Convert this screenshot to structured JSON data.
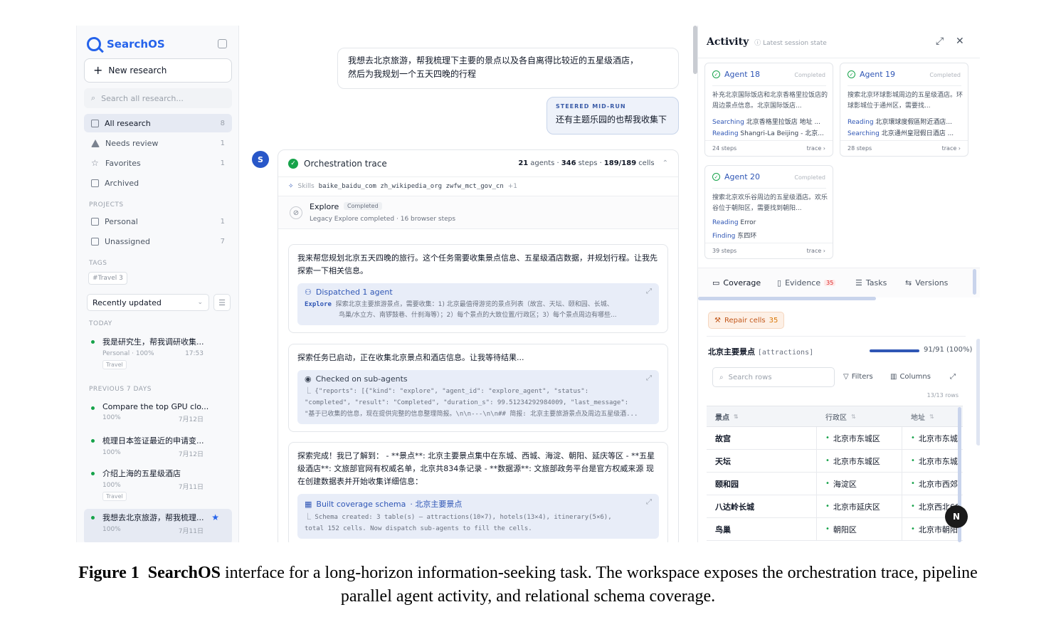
{
  "sidebar": {
    "brand": "SearchOS",
    "new_research": "New research",
    "search_placeholder": "Search all research...",
    "nav": [
      {
        "label": "All research",
        "count": "8"
      },
      {
        "label": "Needs review",
        "count": "1"
      },
      {
        "label": "Favorites",
        "count": "1"
      },
      {
        "label": "Archived",
        "count": ""
      }
    ],
    "projects_label": "PROJECTS",
    "projects": [
      {
        "label": "Personal",
        "count": "1"
      },
      {
        "label": "Unassigned",
        "count": "7"
      }
    ],
    "tags_label": "TAGS",
    "tag": "#Travel 3",
    "sort": "Recently updated",
    "today_label": "TODAY",
    "previous_label": "PREVIOUS 7 DAYS",
    "history": [
      {
        "title": "我是研究生，帮我调研收集...",
        "meta1": "Personal · 100%",
        "time": "17:53",
        "chip": "Travel"
      },
      {
        "title": "Compare the top GPU clo...",
        "meta1": "100%",
        "time": "7月12日",
        "chip": ""
      },
      {
        "title": "梳理日本签证最近的申请变...",
        "meta1": "100%",
        "time": "7月12日",
        "chip": ""
      },
      {
        "title": "介绍上海的五星级酒店",
        "meta1": "100%",
        "time": "7月11日",
        "chip": "Travel"
      },
      {
        "title": "我想去北京旅游，帮我梳理...",
        "meta1": "100%",
        "time": "7月11日",
        "chip": ""
      }
    ]
  },
  "chat": {
    "user_message_1": "我想去北京旅游，帮我梳理下主要的景点以及各自离得比较近的五星级酒店，",
    "user_message_2": "然后为我规划一个五天四晚的行程",
    "steer_label": "STEERED MID-RUN",
    "steer_message": "还有主题乐园的也帮我收集下",
    "avatar": "S",
    "trace": {
      "title": "Orchestration trace",
      "agents_num": "21",
      "agents_label": "agents ·",
      "steps_num": "346",
      "steps_label": "steps ·",
      "cells_num": "189/189",
      "cells_label": "cells",
      "skills_label": "Skills",
      "skills": "baike_baidu_com zh_wikipedia_org zwfw_mct_gov_cn",
      "skills_more": "+1",
      "explore_name": "Explore",
      "explore_badge": "Completed",
      "explore_sub": "Legacy Explore completed · 16 browser steps"
    },
    "cards": [
      {
        "text": "我来帮您规划北京五天四晚的旅行。这个任务需要收集景点信息、五星级酒店数据，并规划行程。让我先探索一下相关信息。",
        "tool_title": "Dispatched 1 agent",
        "tool_kw": "Explore",
        "tool_body_1": "探索北京主要旅游景点，需要收集：1) 北京最值得游览的景点列表（故宫、天坛、颐和园、长城、",
        "tool_body_2": "鸟巢/水立方、南锣鼓巷、什刹海等）；2）每个景点的大致位置/行政区；3）每个景点周边有哪些..."
      },
      {
        "text": "探索任务已启动，正在收集北京景点和酒店信息。让我等待结果...",
        "tool_title": "Checked on sub-agents",
        "mono_1": "⎿ {\"reports\": [{\"kind\": \"explore\", \"agent_id\": \"explore_agent\", \"status\":",
        "mono_2": "\"completed\", \"result\": \"Completed\", \"duration_s\": 99.51234292984009, \"last_message\":",
        "mono_3": "\"基于已收集的信息，现在提供完整的信息整理简报。\\n\\n---\\n\\n## 简报: 北京主要旅游景点及周边五星级酒..."
      },
      {
        "text": "探索完成！我已了解到： - **景点**: 北京主要景点集中在东城、西城、海淀、朝阳、延庆等区 - **五星级酒店**: 文旅部官网有权威名单，北京共834条记录 - **数据源**: 文旅部政务平台是官方权威来源 现在创建数据表并开始收集详细信息：",
        "tool_title": "Built coverage schema",
        "tool_title_sub": "· 北京主要景点",
        "mono_1": "⎿ Schema created: 3 table(s) — attractions(10×7), hotels(13×4), itinerary(5×6),",
        "mono_2": "total 152 cells. Now dispatch sub-agents to fill the cells."
      }
    ]
  },
  "activity": {
    "title": "Activity",
    "subtitle": "Latest session state",
    "agents": [
      {
        "name": "Agent 18",
        "status": "Completed",
        "desc": "补充北京国际饭店和北京香格里拉饭店的周边景点信息。北京国际饭店...",
        "verb1": "Searching",
        "obj1": "北京香格里拉饭店 地址 ...",
        "verb2": "Reading",
        "obj2": "Shangri-La Beijing - 北京...",
        "steps": "24 steps",
        "trace": "trace ›"
      },
      {
        "name": "Agent 19",
        "status": "Completed",
        "desc": "搜索北京环球影城周边的五星级酒店。环球影城位于通州区，需要找...",
        "verb1": "Reading",
        "obj1": "北京環球度假區附近酒店...",
        "verb2": "Searching",
        "obj2": "北京通州皇冠假日酒店 ...",
        "steps": "28 steps",
        "trace": "trace ›"
      },
      {
        "name": "Agent 20",
        "status": "Completed",
        "desc": "搜索北京欢乐谷周边的五星级酒店。欢乐谷位于朝阳区，需要找到朝阳...",
        "verb1": "Reading",
        "obj1": "Error",
        "verb2": "Finding",
        "obj2": "东四环",
        "steps": "39 steps",
        "trace": "trace ›"
      }
    ],
    "tabs": [
      {
        "label": "Coverage",
        "badge": ""
      },
      {
        "label": "Evidence",
        "badge": "35"
      },
      {
        "label": "Tasks",
        "badge": ""
      },
      {
        "label": "Versions",
        "badge": ""
      }
    ],
    "repair_label": "Repair cells",
    "repair_count": "35",
    "schema_title": "北京主要景点",
    "schema_key": "[attractions]",
    "progress_fraction": 1.0,
    "progress_text": "91/91 (100%)",
    "search_rows": "Search rows",
    "filters": "Filters",
    "columns": "Columns",
    "rows_count": "13/13 rows",
    "table_headers": [
      "景点",
      "行政区",
      "地址"
    ],
    "rows": [
      [
        "故宫",
        "北京市东城区",
        "北京市东城"
      ],
      [
        "天坛",
        "北京市东城区",
        "北京市东城"
      ],
      [
        "颐和园",
        "海淀区",
        "北京市西郊"
      ],
      [
        "八达岭长城",
        "北京市延庆区",
        "北京西北60"
      ],
      [
        "鸟巢",
        "朝阳区",
        "北京市朝阳"
      ]
    ],
    "floating_badge": "N"
  },
  "caption": {
    "label": "Figure 1",
    "name": "SearchOS",
    "text_1": "interface for a long-horizon information-seeking task. The workspace exposes the orchestration trace, pipeline",
    "text_2": "parallel agent activity, and relational schema coverage."
  },
  "colors": {
    "accent": "#2563eb",
    "success": "#16a34a",
    "repair": "#c2571a"
  },
  "icons": [
    "search-icon",
    "plus-icon",
    "inbox-icon",
    "warning-icon",
    "star-icon",
    "archive-icon",
    "folder-icon",
    "check-circle-icon",
    "expand-icon",
    "close-icon"
  ]
}
